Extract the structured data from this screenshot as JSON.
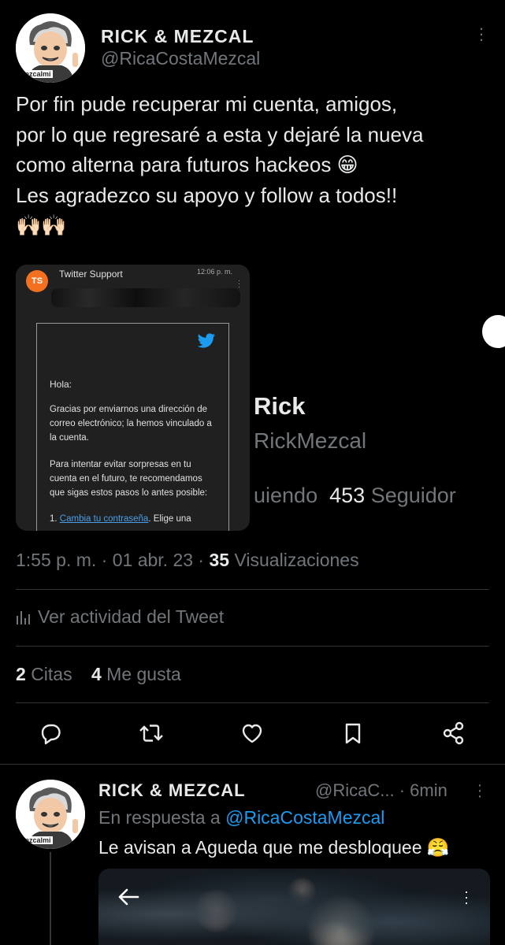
{
  "tweet": {
    "author": {
      "display_name": "RICK & MEZCAL",
      "handle": "@RicaCostaMezcal",
      "avatar_text": "mezcalmi"
    },
    "text": "Por fin pude recuperar mi cuenta, amigos,\npor lo que regresaré a esta y dejaré la nueva\ncomo alterna para futuros hackeos 😁\nLes agradezco su apoyo y follow a todos!!\n🙌🏻🙌🏻",
    "media": {
      "sender_initials": "TS",
      "sender_name": "Twitter Support",
      "time": "12:06 p. m.",
      "email_greeting": "Hola:",
      "email_paragraph_1": "Gracias por enviarnos una dirección de correo electrónico; la hemos vinculado a la cuenta.",
      "email_paragraph_2": "Para intentar evitar sorpresas en tu cuenta en el futuro, te recomendamos que sigas estos pasos lo antes posible:",
      "email_item_number": "1.",
      "email_item_link": "Cambia tu contraseña",
      "email_item_rest": ". Elige una"
    },
    "bleed_profile": {
      "name": "Rick",
      "handle": "RickMezcal",
      "following_fragment": "uiendo",
      "followers_count": "453",
      "followers_label": "Seguidor"
    },
    "time": "1:55 p. m.",
    "date": "01 abr. 23",
    "views_count": "35",
    "views_label": "Visualizaciones",
    "activity_label": "Ver actividad del Tweet",
    "stats": {
      "quotes_count": "2",
      "quotes_label": "Citas",
      "likes_count": "4",
      "likes_label": "Me gusta"
    },
    "actions": [
      "reply-icon",
      "retweet-icon",
      "like-icon",
      "bookmark-icon",
      "share-icon"
    ]
  },
  "reply": {
    "author": {
      "display_name": "RICK & MEZCAL",
      "handle_truncated": "@RicaC...",
      "separator": "·",
      "time": "6min",
      "avatar_text": "mezcalmi"
    },
    "in_reply_to_label": "En respuesta a",
    "in_reply_to_handle": "@RicaCostaMezcal",
    "text": "Le avisan a Agueda que me desbloquee 😤"
  },
  "colors": {
    "background": "#000000",
    "text_primary": "#e7e9ea",
    "text_secondary": "#71767b",
    "accent": "#1d9bf0",
    "divider": "#2f3336"
  }
}
